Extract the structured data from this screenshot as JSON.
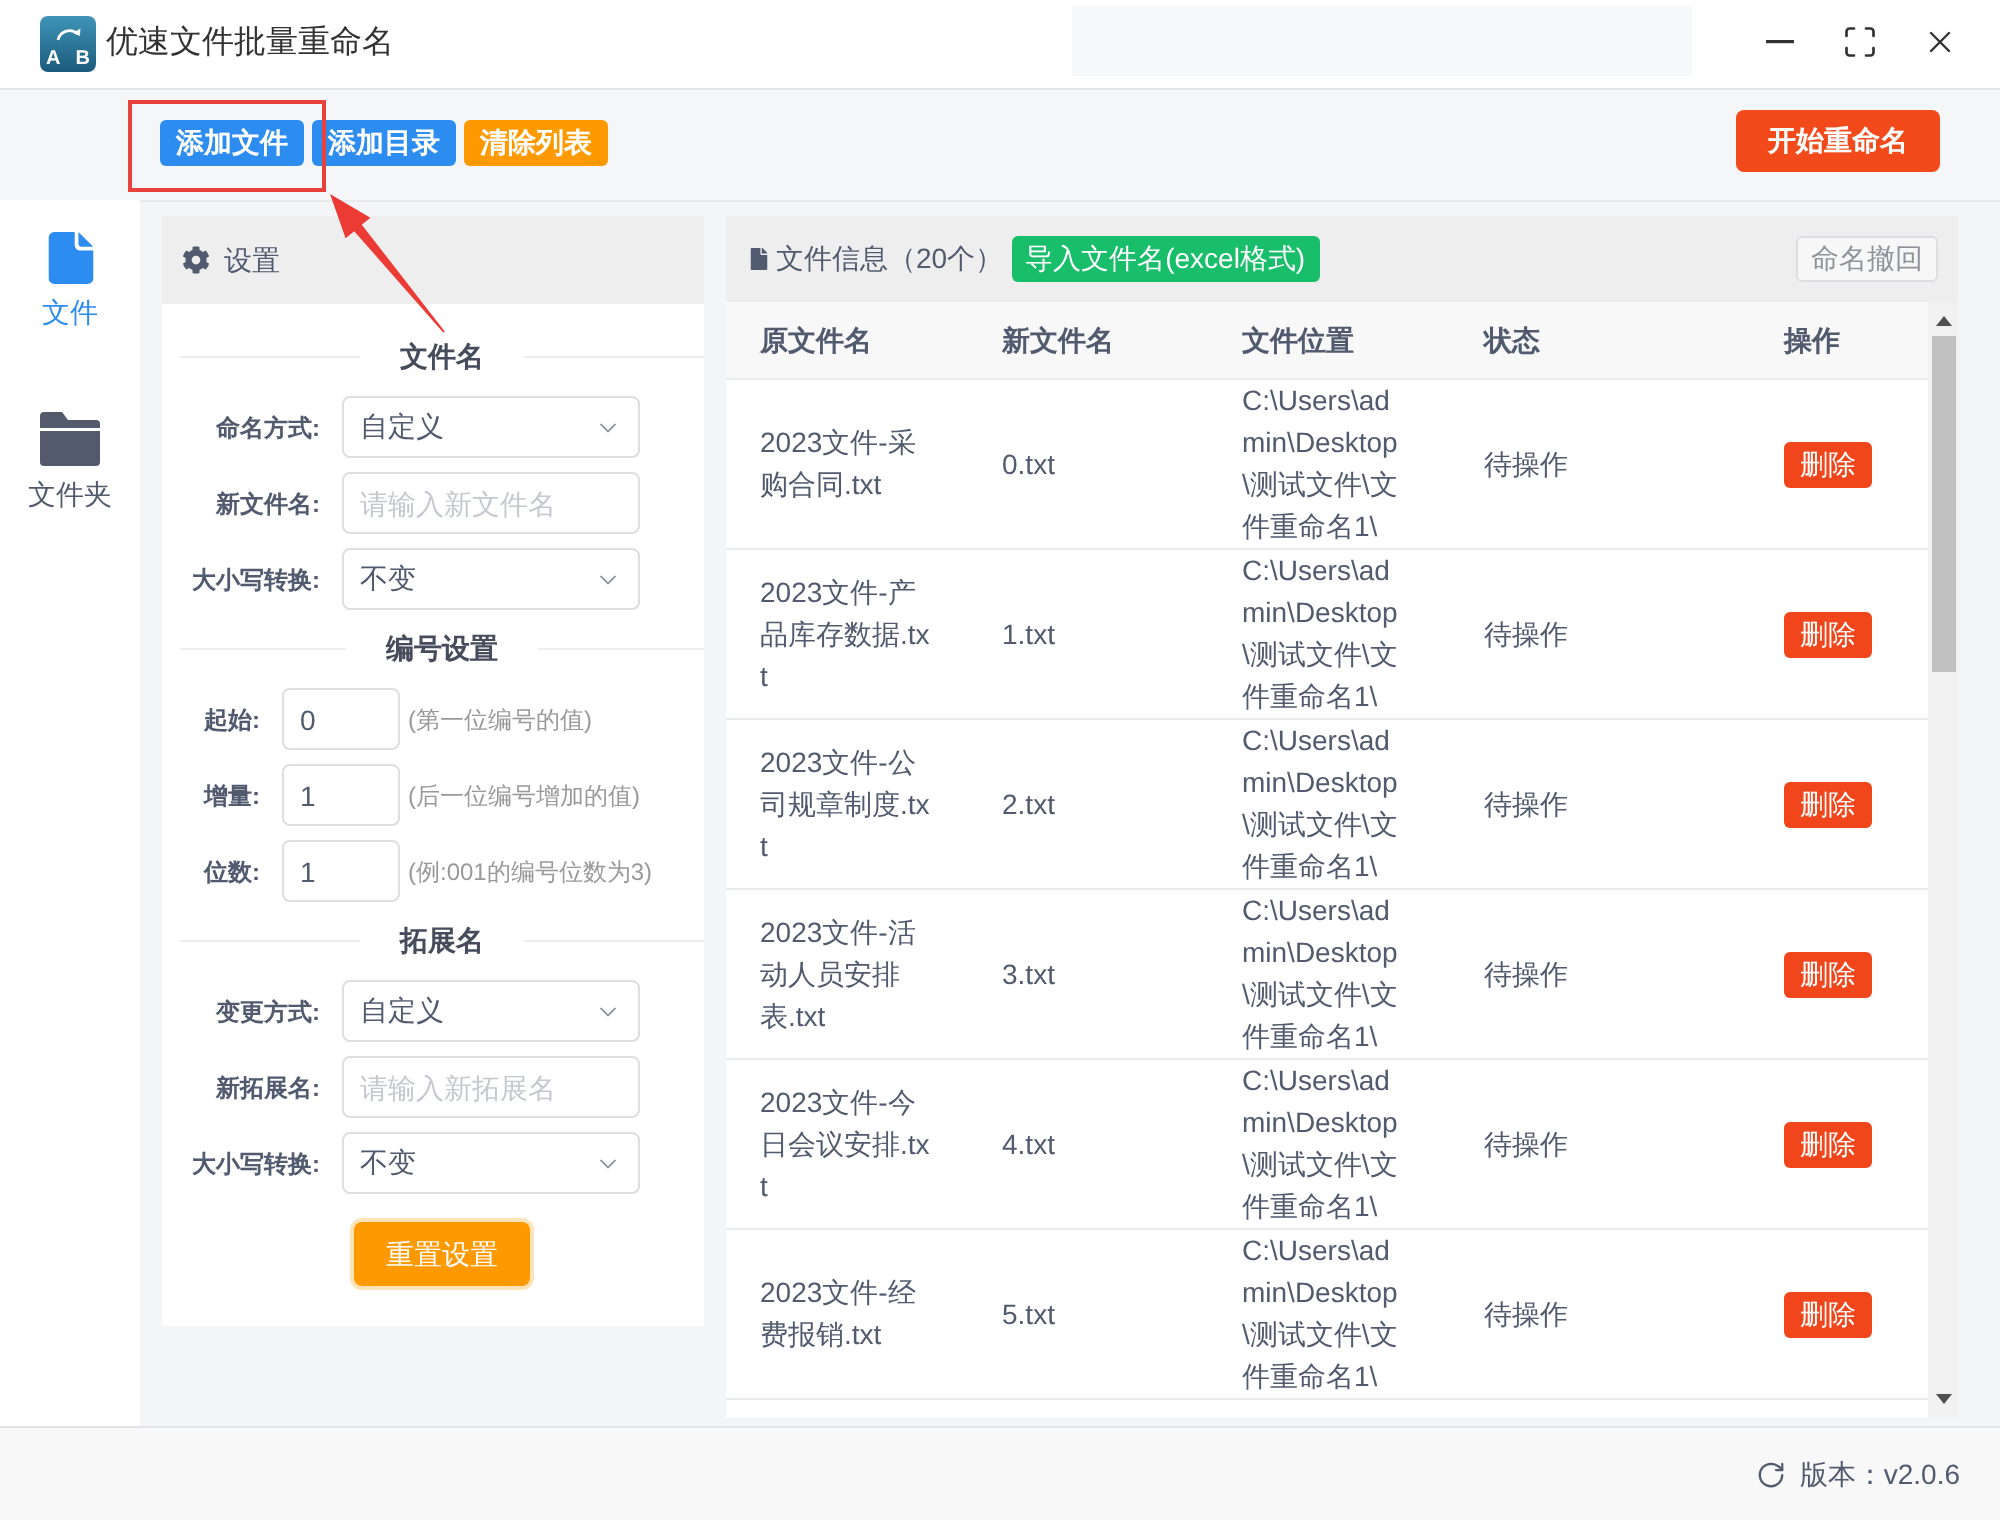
{
  "window": {
    "title": "优速文件批量重命名",
    "logo": {
      "letters": [
        "A",
        "B"
      ]
    }
  },
  "toolbar": {
    "buttons": [
      {
        "label": "添加文件",
        "kind": "primary"
      },
      {
        "label": "添加目录",
        "kind": "primary"
      },
      {
        "label": "清除列表",
        "kind": "warning"
      }
    ],
    "start_button": "开始重命名"
  },
  "sidebar": {
    "items": [
      {
        "label": "文件",
        "kind": "file",
        "selected": true
      },
      {
        "label": "文件夹",
        "kind": "folder",
        "selected": false
      }
    ]
  },
  "settings": {
    "title": "设置",
    "sections": [
      {
        "title": "文件名",
        "rows": [
          {
            "label": "命名方式:",
            "kind": "select",
            "value": "自定义"
          },
          {
            "label": "新文件名:",
            "kind": "text",
            "placeholder": "请输入新文件名"
          },
          {
            "label": "大小写转换:",
            "kind": "select",
            "value": "不变"
          }
        ]
      },
      {
        "title": "编号设置",
        "rows": [
          {
            "label": "起始:",
            "kind": "number",
            "value": "0",
            "hint": "(第一位编号的值)"
          },
          {
            "label": "增量:",
            "kind": "number",
            "value": "1",
            "hint": "(后一位编号增加的值)"
          },
          {
            "label": "位数:",
            "kind": "number",
            "value": "1",
            "hint": "(例:001的编号位数为3)"
          }
        ]
      },
      {
        "title": "拓展名",
        "rows": [
          {
            "label": "变更方式:",
            "kind": "select",
            "value": "自定义"
          },
          {
            "label": "新拓展名:",
            "kind": "text",
            "placeholder": "请输入新拓展名"
          },
          {
            "label": "大小写转换:",
            "kind": "select",
            "value": "不变"
          }
        ]
      }
    ],
    "reset_button": "重置设置"
  },
  "files": {
    "title": "文件信息（20个）",
    "import_button": "导入文件名(excel格式)",
    "undo_button": {
      "label": "命名撤回",
      "disabled": true
    },
    "columns": [
      "原文件名",
      "新文件名",
      "文件位置",
      "状态",
      "操作"
    ],
    "rows": [
      {
        "original_name": "2023文件-采购合同.txt",
        "new_name": "0.txt",
        "location": "C:\\Users\\admin\\Desktop\\测试文件\\文件重命名1\\",
        "status": "待操作",
        "action": "删除"
      },
      {
        "original_name": "2023文件-产品库存数据.txt",
        "new_name": "1.txt",
        "location": "C:\\Users\\admin\\Desktop\\测试文件\\文件重命名1\\",
        "status": "待操作",
        "action": "删除"
      },
      {
        "original_name": "2023文件-公司规章制度.txt",
        "new_name": "2.txt",
        "location": "C:\\Users\\admin\\Desktop\\测试文件\\文件重命名1\\",
        "status": "待操作",
        "action": "删除"
      },
      {
        "original_name": "2023文件-活动人员安排表.txt",
        "new_name": "3.txt",
        "location": "C:\\Users\\admin\\Desktop\\测试文件\\文件重命名1\\",
        "status": "待操作",
        "action": "删除"
      },
      {
        "original_name": "2023文件-今日会议安排.txt",
        "new_name": "4.txt",
        "location": "C:\\Users\\admin\\Desktop\\测试文件\\文件重命名1\\",
        "status": "待操作",
        "action": "删除"
      },
      {
        "original_name": "2023文件-经费报销.txt",
        "new_name": "5.txt",
        "location": "C:\\Users\\admin\\Desktop\\测试文件\\文件重命名1\\",
        "status": "待操作",
        "action": "删除"
      }
    ]
  },
  "status_bar": {
    "version": "版本：v2.0.6"
  }
}
